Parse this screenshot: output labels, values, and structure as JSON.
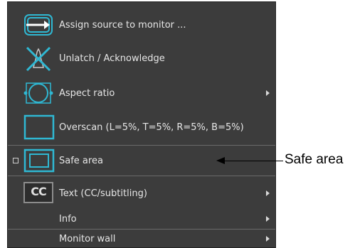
{
  "menu": {
    "items": [
      {
        "label": "Assign source to monitor ...",
        "submenu": false
      },
      {
        "label": "Unlatch / Acknowledge",
        "submenu": false
      },
      {
        "label": "Aspect ratio",
        "submenu": true
      },
      {
        "label": "Overscan (L=5%, T=5%, R=5%, B=5%)",
        "submenu": false
      },
      {
        "label": "Safe area",
        "submenu": false,
        "checked": false
      },
      {
        "label": "Text (CC/subtitling)",
        "submenu": true
      },
      {
        "label": "Info",
        "submenu": true
      },
      {
        "label": "Monitor wall",
        "submenu": true
      }
    ],
    "cc_icon_text": "CC"
  },
  "callout": {
    "label": "Safe area"
  },
  "colors": {
    "menu_bg": "#3c3c3c",
    "icon_cyan": "#2fb8d3",
    "text": "#e6e6e6"
  }
}
